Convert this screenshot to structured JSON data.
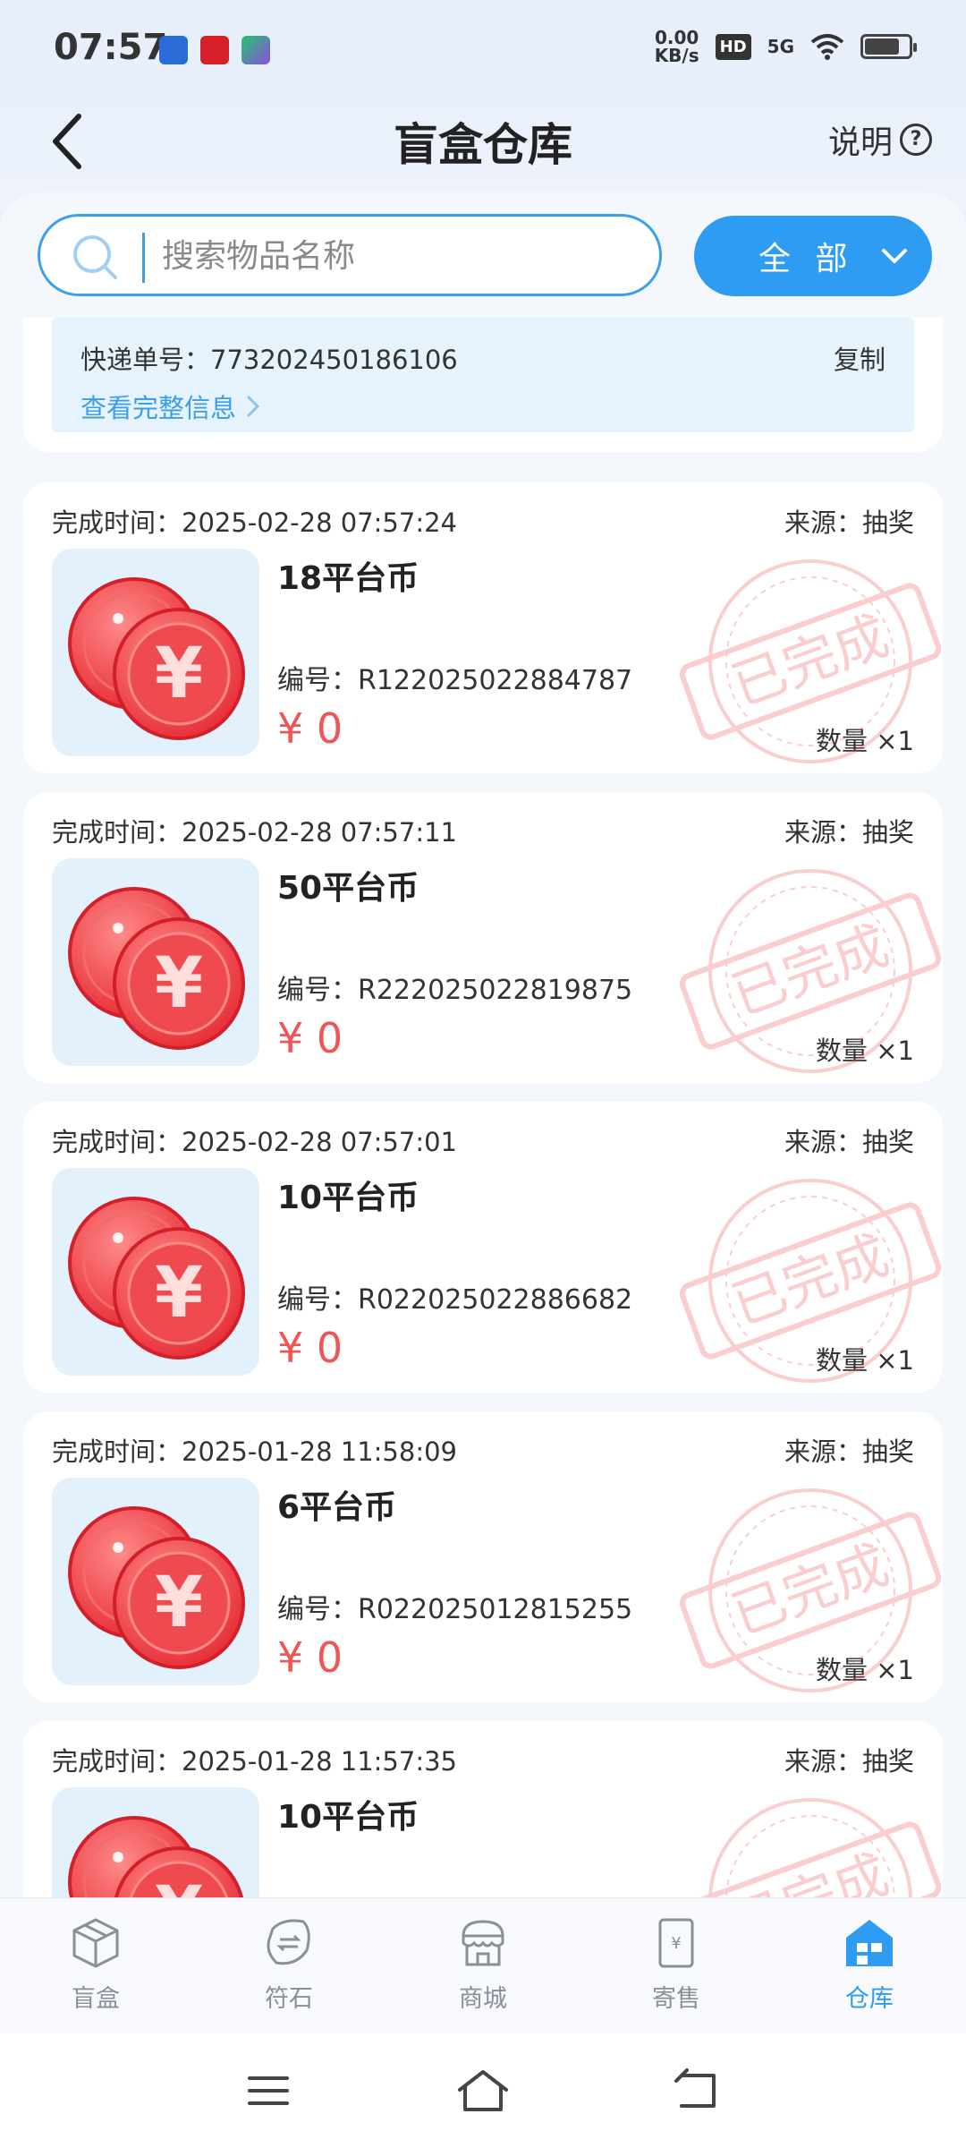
{
  "status_bar": {
    "time": "07:57",
    "net_speed_value": "0.00",
    "net_speed_unit": "KB/s",
    "hd": "HD",
    "network": "5G",
    "battery_level": 0.8
  },
  "header": {
    "title": "盲盒仓库",
    "help_label": "说明"
  },
  "search": {
    "placeholder": "搜索物品名称",
    "value": ""
  },
  "filter": {
    "label": "全 部"
  },
  "partial_card": {
    "express_label": "快递单号：773202450186106",
    "copy_label": "复制",
    "detail_link": "查看完整信息"
  },
  "cards": [
    {
      "time": "完成时间：2025-02-28 07:57:24",
      "source": "来源：抽奖",
      "name": "18平台币",
      "code": "编号：R122025022884787",
      "price": "¥ 0",
      "qty": "数量 ×1",
      "stamp": "已完成"
    },
    {
      "time": "完成时间：2025-02-28 07:57:11",
      "source": "来源：抽奖",
      "name": "50平台币",
      "code": "编号：R222025022819875",
      "price": "¥ 0",
      "qty": "数量 ×1",
      "stamp": "已完成"
    },
    {
      "time": "完成时间：2025-02-28 07:57:01",
      "source": "来源：抽奖",
      "name": "10平台币",
      "code": "编号：R022025022886682",
      "price": "¥ 0",
      "qty": "数量 ×1",
      "stamp": "已完成"
    },
    {
      "time": "完成时间：2025-01-28 11:58:09",
      "source": "来源：抽奖",
      "name": "6平台币",
      "code": "编号：R022025012815255",
      "price": "¥ 0",
      "qty": "数量 ×1",
      "stamp": "已完成"
    },
    {
      "time": "完成时间：2025-01-28 11:57:35",
      "source": "来源：抽奖",
      "name": "10平台币",
      "code": "",
      "price": "",
      "qty": "",
      "stamp": "已完成"
    }
  ],
  "bottom_nav": [
    {
      "label": "盲盒",
      "icon": "box-icon"
    },
    {
      "label": "符石",
      "icon": "rune-icon"
    },
    {
      "label": "商城",
      "icon": "shop-icon"
    },
    {
      "label": "寄售",
      "icon": "consign-icon"
    },
    {
      "label": "仓库",
      "icon": "warehouse-icon",
      "active": true
    }
  ],
  "colors": {
    "accent": "#2f9cf3",
    "price": "#f05454",
    "stamp": "#f05454"
  }
}
